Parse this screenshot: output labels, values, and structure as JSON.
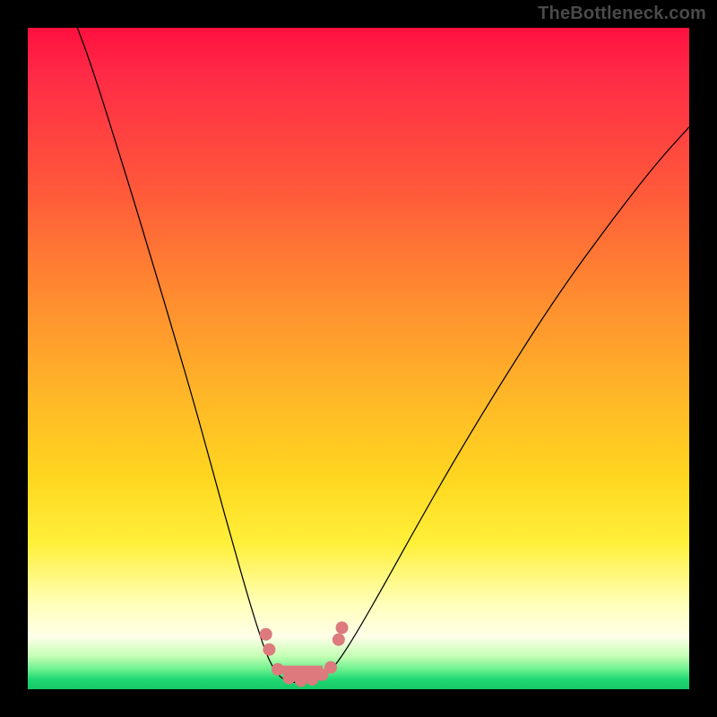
{
  "watermark": "TheBottleneck.com",
  "chart_data": {
    "type": "line",
    "title": "",
    "xlabel": "",
    "ylabel": "",
    "xlim": [
      0,
      1
    ],
    "ylim": [
      0,
      1
    ],
    "series": [
      {
        "name": "bottleneck-curve",
        "points": [
          [
            0.075,
            1.0
          ],
          [
            0.09,
            0.96
          ],
          [
            0.11,
            0.9
          ],
          [
            0.135,
            0.82
          ],
          [
            0.16,
            0.74
          ],
          [
            0.19,
            0.64
          ],
          [
            0.22,
            0.54
          ],
          [
            0.255,
            0.42
          ],
          [
            0.285,
            0.31
          ],
          [
            0.31,
            0.22
          ],
          [
            0.33,
            0.15
          ],
          [
            0.345,
            0.1
          ],
          [
            0.36,
            0.055
          ],
          [
            0.372,
            0.03
          ],
          [
            0.385,
            0.015
          ],
          [
            0.4,
            0.01
          ],
          [
            0.42,
            0.01
          ],
          [
            0.44,
            0.015
          ],
          [
            0.458,
            0.028
          ],
          [
            0.475,
            0.05
          ],
          [
            0.5,
            0.09
          ],
          [
            0.54,
            0.16
          ],
          [
            0.59,
            0.25
          ],
          [
            0.65,
            0.355
          ],
          [
            0.72,
            0.47
          ],
          [
            0.8,
            0.595
          ],
          [
            0.88,
            0.705
          ],
          [
            0.95,
            0.795
          ],
          [
            1.0,
            0.85
          ]
        ]
      }
    ],
    "markers": {
      "name": "highlight-dots",
      "color": "#dd7a7d",
      "radius_px": 7,
      "points": [
        [
          0.36,
          0.083
        ],
        [
          0.365,
          0.06
        ],
        [
          0.378,
          0.03
        ],
        [
          0.395,
          0.017
        ],
        [
          0.413,
          0.013
        ],
        [
          0.43,
          0.015
        ],
        [
          0.445,
          0.022
        ],
        [
          0.458,
          0.033
        ],
        [
          0.47,
          0.075
        ],
        [
          0.475,
          0.093
        ]
      ]
    },
    "valley_fill": {
      "name": "valley-pink-fill",
      "color": "#dd7a7d",
      "points_normalized": [
        [
          0.378,
          0.03
        ],
        [
          0.395,
          0.017
        ],
        [
          0.413,
          0.013
        ],
        [
          0.43,
          0.015
        ],
        [
          0.445,
          0.022
        ],
        [
          0.445,
          0.035
        ],
        [
          0.413,
          0.035
        ],
        [
          0.378,
          0.035
        ]
      ]
    }
  }
}
